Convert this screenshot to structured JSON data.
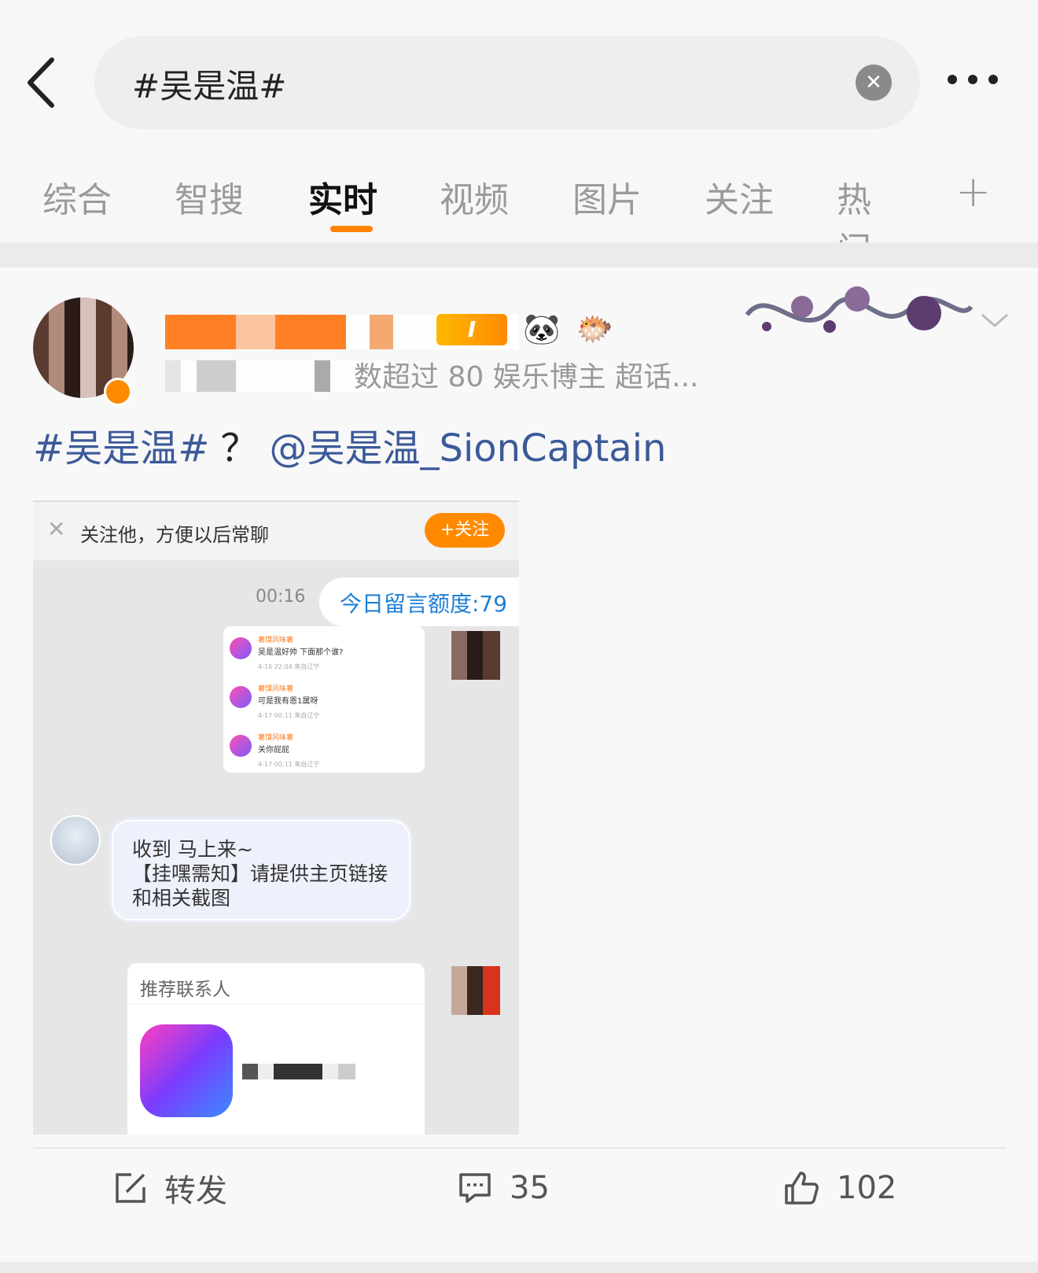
{
  "search": {
    "query": "#吴是温#"
  },
  "tabs": [
    {
      "label": "综合"
    },
    {
      "label": "智搜"
    },
    {
      "label": "实时"
    },
    {
      "label": "视频"
    },
    {
      "label": "图片"
    },
    {
      "label": "关注"
    },
    {
      "label": "热门"
    }
  ],
  "active_tab": "实时",
  "post": {
    "author_meta": "数超过 80  娱乐博主 超话...",
    "text_topic": "#吴是温#",
    "text_q": "？",
    "text_mention": "@吴是温_SionCaptain",
    "screenshot": {
      "follow_hint": "关注他，方便以后常聊",
      "follow_button": "+关注",
      "time": "00:16",
      "bubble1": "今日留言额度:79",
      "card_rows": [
        {
          "name": "薯馍风味薯",
          "text": "吴是温好帅 下面那个谁?",
          "meta": "4-16 22:04 来自辽宁"
        },
        {
          "name": "薯馍风味薯",
          "text": "可是我有恩1属呀",
          "meta": "4-17 00:11 来自辽宁"
        },
        {
          "name": "薯馍风味薯",
          "text": "关你屁屁",
          "meta": "4-17 00:11 来自辽宁"
        }
      ],
      "reply": "收到 马上来~\n【挂嘿需知】请提供主页链接\n和相关截图",
      "rec_title": "推荐联系人"
    },
    "actions": {
      "repost_label": "转发",
      "comment_count": "35",
      "like_count": "102"
    }
  },
  "colors": {
    "accent": "#ff8200",
    "link": "#3c5a99"
  }
}
